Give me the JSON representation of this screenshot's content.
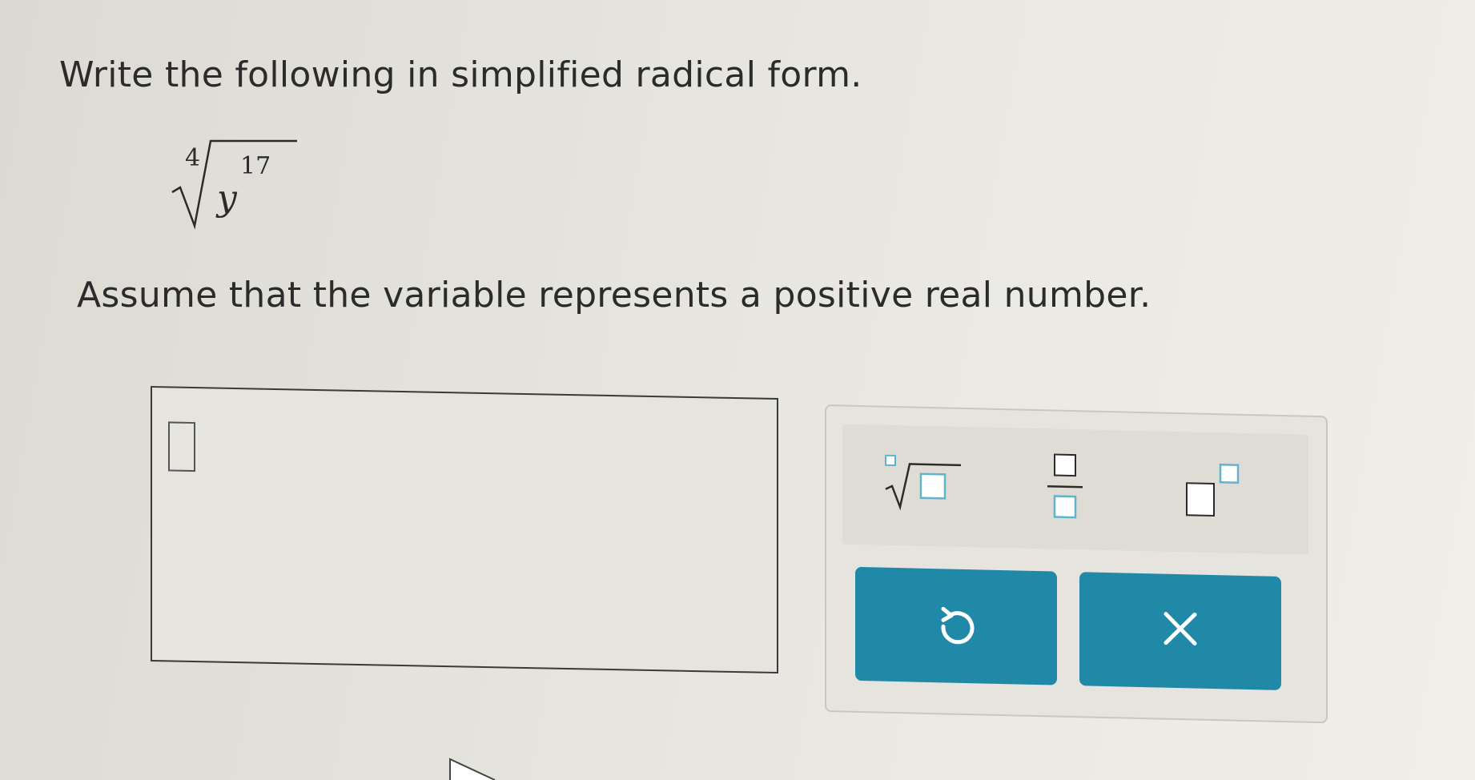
{
  "question": {
    "prompt": "Write the following in simplified radical form.",
    "expression": {
      "index": "4",
      "base": "y",
      "exponent": "17"
    },
    "assumption": "Assume that the variable represents a positive real number."
  },
  "answer": {
    "value": ""
  },
  "palette": {
    "tools": [
      {
        "name": "nth-root",
        "icon": "nth-root-icon"
      },
      {
        "name": "fraction",
        "icon": "fraction-icon"
      },
      {
        "name": "exponent",
        "icon": "exponent-icon"
      }
    ],
    "buttons": [
      {
        "name": "undo",
        "icon": "undo-icon"
      },
      {
        "name": "clear",
        "icon": "clear-icon"
      }
    ]
  },
  "colors": {
    "accent": "#2189a8",
    "placeholder": "#5fb6cc",
    "text": "#2b2b2b"
  }
}
